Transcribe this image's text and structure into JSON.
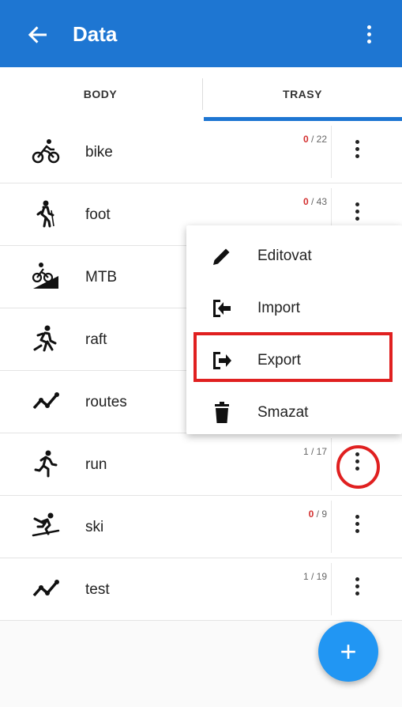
{
  "appbar": {
    "title": "Data",
    "back_icon": "arrow-left-icon",
    "menu_icon": "more-vert-icon",
    "color": "#1e76d2"
  },
  "tabs": [
    {
      "label": "BODY",
      "active": false
    },
    {
      "label": "TRASY",
      "active": true
    }
  ],
  "rows": [
    {
      "label": "bike",
      "icon": "bike-icon",
      "count_used": "0",
      "count_total": "22",
      "zero": true
    },
    {
      "label": "foot",
      "icon": "hiking-icon",
      "count_used": "0",
      "count_total": "43",
      "zero": true
    },
    {
      "label": "MTB",
      "icon": "mtb-icon",
      "count_used": "",
      "count_total": "",
      "zero": false
    },
    {
      "label": "raft",
      "icon": "raft-icon",
      "count_used": "",
      "count_total": "",
      "zero": false
    },
    {
      "label": "routes",
      "icon": "route-icon",
      "count_used": "",
      "count_total": "",
      "zero": false
    },
    {
      "label": "run",
      "icon": "run-icon",
      "count_used": "1",
      "count_total": "17",
      "zero": false
    },
    {
      "label": "ski",
      "icon": "ski-icon",
      "count_used": "0",
      "count_total": "9",
      "zero": true
    },
    {
      "label": "test",
      "icon": "route-icon",
      "count_used": "1",
      "count_total": "19",
      "zero": false
    }
  ],
  "popup": {
    "items": [
      {
        "label": "Editovat",
        "icon": "pencil-icon"
      },
      {
        "label": "Import",
        "icon": "import-icon"
      },
      {
        "label": "Export",
        "icon": "export-icon"
      },
      {
        "label": "Smazat",
        "icon": "trash-icon"
      }
    ]
  },
  "fab": {
    "label": "+",
    "icon": "add-icon",
    "color": "#2196f3"
  },
  "highlight_color": "#e02020"
}
